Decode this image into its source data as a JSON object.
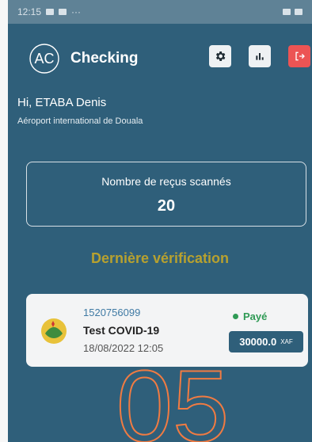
{
  "status_bar": {
    "time": "12:15",
    "left_extra": "···"
  },
  "header": {
    "title": "Checking",
    "logo_text": "AC"
  },
  "user": {
    "greeting": "Hi, ETABA Denis",
    "location": "Aéroport international de Douala"
  },
  "summary": {
    "label": "Nombre de reçus scannés",
    "count": "20"
  },
  "last_check": {
    "title": "Dernière vérification",
    "receipt": {
      "id": "1520756099",
      "test_name": "Test COVID-19",
      "date": "18/08/2022 12:05",
      "status": "Payé",
      "amount": "30000.0",
      "currency": "XAF"
    }
  },
  "overlay": {
    "number": "05"
  },
  "colors": {
    "primary": "#2f5f7a",
    "accent": "#b7a12f",
    "danger": "#ec5454",
    "success": "#2f9a55",
    "overlay": "#f07b42"
  },
  "icons": {
    "settings": "gear-icon",
    "stats": "bar-chart-icon",
    "logout": "logout-icon"
  }
}
